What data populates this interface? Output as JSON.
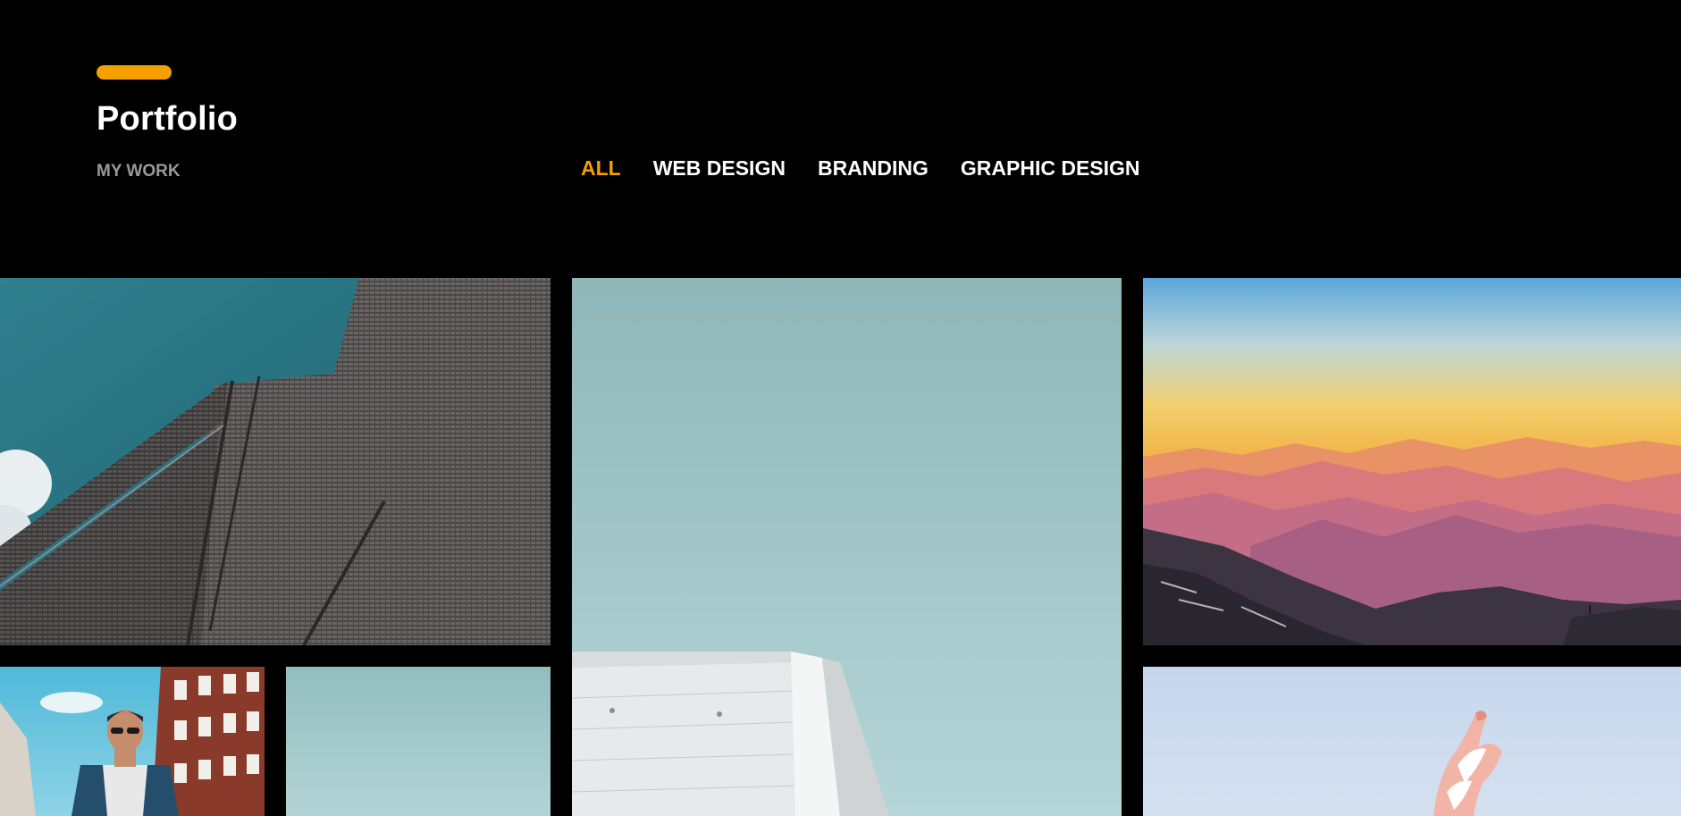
{
  "header": {
    "title": "Portfolio",
    "subtitle": "MY WORK",
    "accent_color": "#f5a000"
  },
  "filters": [
    {
      "label": "ALL",
      "active": true
    },
    {
      "label": "WEB DESIGN",
      "active": false
    },
    {
      "label": "BRANDING",
      "active": false
    },
    {
      "label": "GRAPHIC DESIGN",
      "active": false
    }
  ],
  "gallery": {
    "items": [
      {
        "image": "brick-building-sky"
      },
      {
        "image": "white-building-teal-sky"
      },
      {
        "image": "sunset-mountains"
      },
      {
        "image": "man-street-sunglasses"
      },
      {
        "image": "pale-teal-sky"
      },
      {
        "image": "pink-sculpture-blue-sky"
      }
    ]
  }
}
